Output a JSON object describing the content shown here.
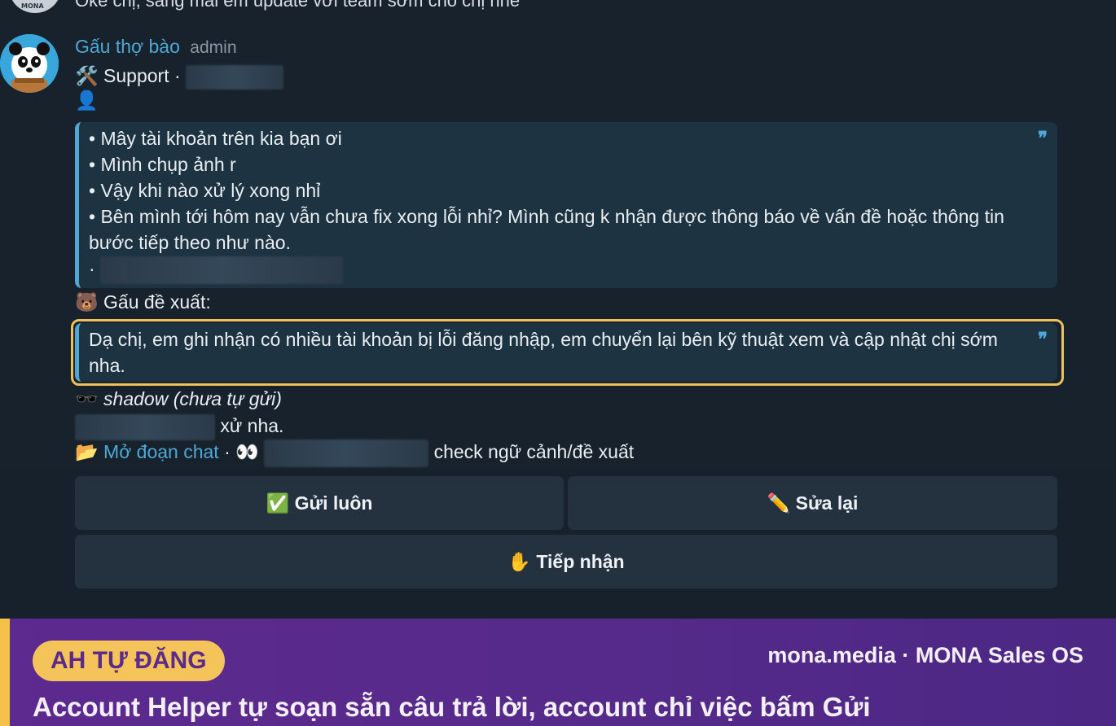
{
  "previous_message": {
    "text": "Oke chị, sáng mai em update với team sớm cho chị nhé",
    "avatar_label": "MONA"
  },
  "message": {
    "sender_name": "Gấu thợ bào",
    "sender_role": "admin",
    "support_icon": "🛠️",
    "support_label": "Support ·",
    "person_icon": "👤",
    "quote_lines": [
      "• Mây tài khoản trên kia bạn ơi",
      "• Mình chụp ảnh r",
      "• Vậy khi nào xử lý xong nhỉ",
      "• Bên mình tới hôm nay vẫn chưa fix xong lỗi nhỉ? Mình cũng k nhận được thông báo về vấn đề hoặc thông tin bước tiếp theo như nào.",
      "·"
    ],
    "quote_mark": "❞",
    "suggest_icon": "🐻",
    "suggest_label": "Gấu đề xuất:",
    "suggestion_text": "Dạ chị, em ghi nhận có nhiều tài khoản bị lỗi đăng nhập, em chuyển lại bên kỹ thuật xem và cập nhật chị sớm nha.",
    "shadow_icon": "🕶️",
    "shadow_label": "shadow (chưa tự gửi)",
    "shadow_text_suffix": "xử nha.",
    "folder_icon": "📂",
    "open_chat_link": "Mở đoạn chat",
    "separator": "·",
    "eyes_icon": "👀",
    "context_suffix": "check ngữ cảnh/đề xuất"
  },
  "buttons": {
    "send_now": "✅ Gửi luôn",
    "edit": "✏️ Sửa lại",
    "accept": "✋ Tiếp nhận"
  },
  "banner": {
    "pill": "AH TỰ ĐĂNG",
    "brand": "mona.media · MONA Sales OS",
    "tagline": "Account Helper tự soạn sẵn câu trả lời, account chỉ việc bấm Gửi"
  },
  "colors": {
    "link": "#4fa7d6",
    "highlight": "#f0c05a",
    "banner": "#5d2a8f",
    "pill_bg": "#f4c35a"
  }
}
